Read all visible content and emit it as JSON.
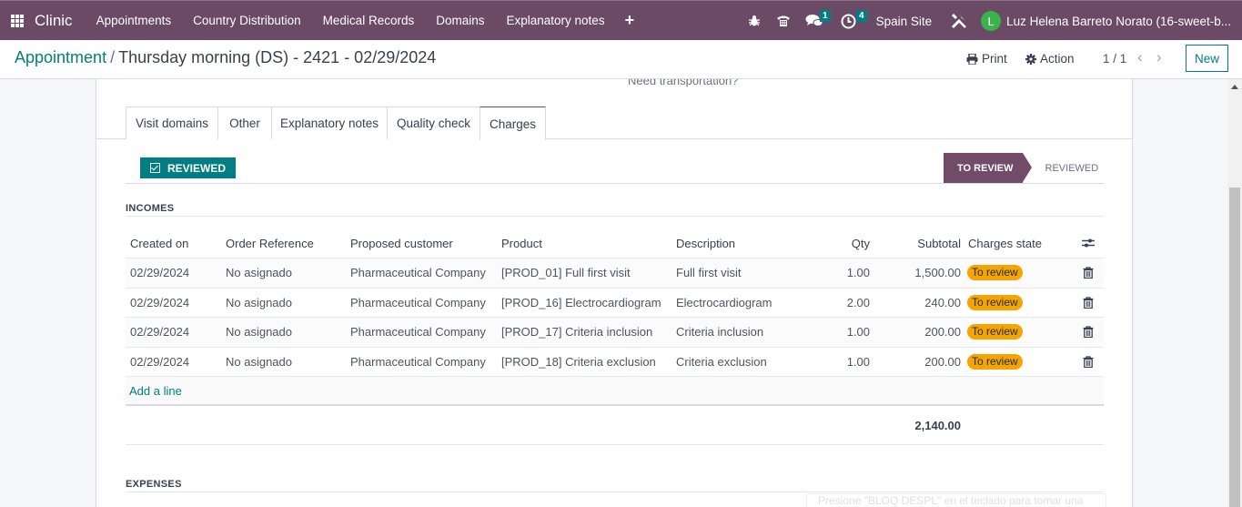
{
  "navbar": {
    "brand": "Clinic",
    "menu": [
      "Appointments",
      "Country Distribution",
      "Medical Records",
      "Domains",
      "Explanatory notes"
    ],
    "plus_icon": "plus-icon",
    "icons": {
      "debug": "bug-icon",
      "phone": "phone-icon",
      "messages": "chat-icon",
      "activities": "clock-icon",
      "settings": "tools-icon"
    },
    "messages_count": "1",
    "activities_count": "4",
    "site": "Spain Site",
    "avatar_initial": "L",
    "user": "Luz Helena Barreto Norato (16-sweet-b..."
  },
  "control": {
    "breadcrumb_parent": "Appointment",
    "breadcrumb_sep": "/",
    "breadcrumb_current": "Thursday morning (DS) - 2421 - 02/29/2024",
    "print_label": "Print",
    "action_label": "Action",
    "pager": "1 / 1",
    "prev": "‹",
    "next": "›",
    "new_label": "New"
  },
  "form": {
    "cut_text": "Need transportation?",
    "tabs": [
      "Visit domains",
      "Other",
      "Explanatory notes",
      "Quality check",
      "Charges"
    ],
    "active_tab": "Charges",
    "reviewed_button": "REVIEWED",
    "status_stages": [
      "TO REVIEW",
      "REVIEWED"
    ],
    "active_stage": "TO REVIEW",
    "incomes_title": "INCOMES",
    "expenses_title": "EXPENSES",
    "columns": [
      "Created on",
      "Order Reference",
      "Proposed customer",
      "Product",
      "Description",
      "Qty",
      "Subtotal",
      "Charges state"
    ],
    "rows": [
      {
        "created_on": "02/29/2024",
        "order_ref": "No asignado",
        "customer": "Pharmaceutical Company",
        "product": "[PROD_01] Full first visit",
        "description": "Full first visit",
        "qty": "1.00",
        "subtotal": "1,500.00",
        "state": "To review"
      },
      {
        "created_on": "02/29/2024",
        "order_ref": "No asignado",
        "customer": "Pharmaceutical Company",
        "product": "[PROD_16] Electrocardiogram",
        "description": "Electrocardiogram",
        "qty": "2.00",
        "subtotal": "240.00",
        "state": "To review"
      },
      {
        "created_on": "02/29/2024",
        "order_ref": "No asignado",
        "customer": "Pharmaceutical Company",
        "product": "[PROD_17] Criteria inclusion",
        "description": "Criteria inclusion",
        "qty": "1.00",
        "subtotal": "200.00",
        "state": "To review"
      },
      {
        "created_on": "02/29/2024",
        "order_ref": "No asignado",
        "customer": "Pharmaceutical Company",
        "product": "[PROD_18] Criteria exclusion",
        "description": "Criteria exclusion",
        "qty": "1.00",
        "subtotal": "200.00",
        "state": "To review"
      }
    ],
    "add_line": "Add a line",
    "total": "2,140.00",
    "hint": "Presione \"BLOQ DESPL\" en el teclado para tomar una"
  },
  "colors": {
    "brand": "#6b4a66",
    "accent": "#017e84",
    "status_pill": "#f5a400",
    "active_stage": "#714b67"
  }
}
